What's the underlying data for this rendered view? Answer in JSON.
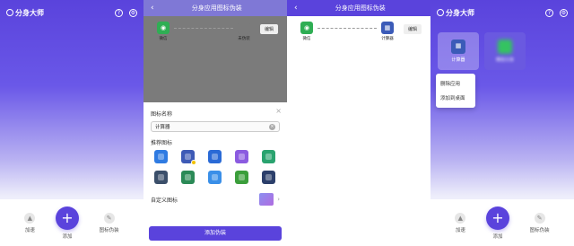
{
  "home": {
    "title": "分身大师",
    "help_icon": "?",
    "nav": {
      "speed": "加速",
      "add": "添加",
      "disguise": "图标伪装"
    }
  },
  "edit": {
    "title": "分身应用图标伪装",
    "source_app": "微信",
    "target_app": "未伪装",
    "edit_button": "编辑",
    "name_label": "图标名称",
    "name_value": "计算器",
    "recommend_label": "推荐图标",
    "custom_label": "自定义图标",
    "submit_button": "添加伪装",
    "recommended_icons": [
      "blue-circle-app",
      "calculator-app",
      "notebook-app",
      "cloud-app",
      "green-doc-app",
      "dark-app",
      "green-map-app",
      "wifi-app",
      "green-pay-app",
      "tv-app"
    ]
  },
  "result": {
    "title": "分身应用图标伪装",
    "source_app": "微信",
    "target_app": "计算器",
    "edit_button": "编辑"
  },
  "home2": {
    "title": "分身大师",
    "card1_label": "计算器",
    "card2_label": "微信分身",
    "menu": [
      "删除应用",
      "添加到桌面"
    ],
    "nav": {
      "speed": "加速",
      "add": "添加",
      "disguise": "图标伪装"
    }
  },
  "colors": {
    "primary": "#5a43dc",
    "wechat": "#2fae54"
  }
}
